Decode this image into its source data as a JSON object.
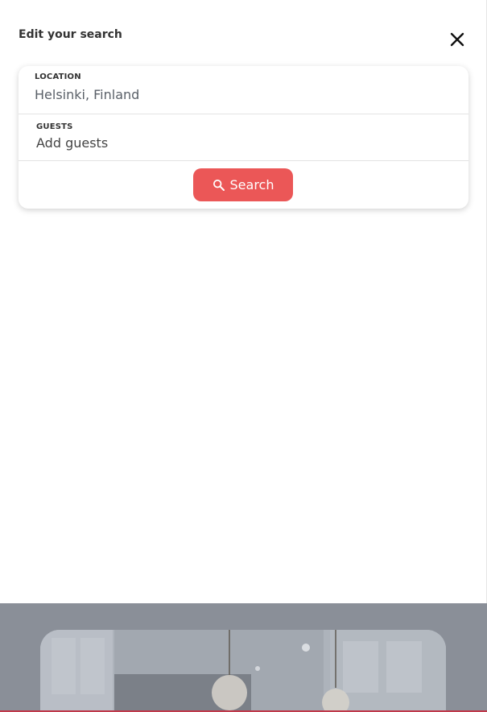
{
  "header": {
    "title": "Edit your search"
  },
  "form": {
    "location": {
      "label": "LOCATION",
      "value": "Helsinki, Finland"
    },
    "guests": {
      "label": "GUESTS",
      "placeholder": "Add guests"
    },
    "search_label": "Search"
  },
  "icons": {
    "close": "close-icon",
    "search": "search-icon"
  },
  "colors": {
    "accent": "#eb5757",
    "overlay": "#8a8f98",
    "bottom_bar": "#c0394b"
  }
}
